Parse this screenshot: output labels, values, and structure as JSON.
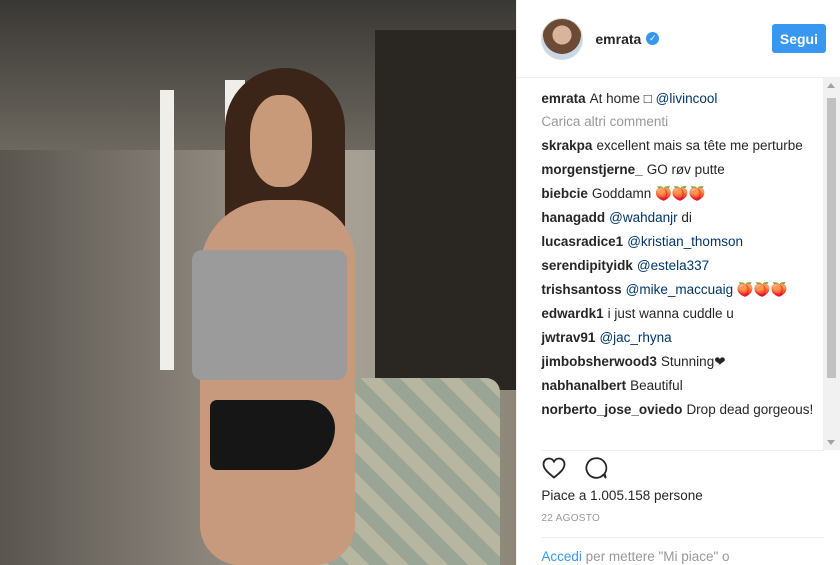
{
  "post": {
    "username": "emrata",
    "verified_icon": "verified-badge-icon",
    "follow_label": "Segui",
    "caption": {
      "author": "emrata",
      "text": "At home □",
      "mention": "@livincool"
    },
    "load_more_label": "Carica altri commenti",
    "comments": [
      {
        "author": "skrakpa",
        "text": "excellent mais sa tête me perturbe",
        "mention": ""
      },
      {
        "author": "morgenstjerne_",
        "text": "GO røv putte",
        "mention": ""
      },
      {
        "author": "biebcie",
        "text": "Goddamn 🍑🍑🍑",
        "mention": ""
      },
      {
        "author": "hanagadd",
        "text": "",
        "mention": "@wahdanjr",
        "after": " di"
      },
      {
        "author": "lucasradice1",
        "text": "",
        "mention": "@kristian_thomson"
      },
      {
        "author": "serendipityidk",
        "text": "",
        "mention": "@estela337"
      },
      {
        "author": "trishsantoss",
        "text": "",
        "mention": "@mike_maccuaig",
        "after": " 🍑🍑🍑"
      },
      {
        "author": "edwardk1",
        "text": "i just wanna cuddle u",
        "mention": ""
      },
      {
        "author": "jwtrav91",
        "text": "",
        "mention": "@jac_rhyna"
      },
      {
        "author": "jimbobsherwood3",
        "text": "Stunning❤",
        "mention": ""
      },
      {
        "author": "nabhanalbert",
        "text": "Beautiful",
        "mention": ""
      },
      {
        "author": "norberto_jose_oviedo",
        "text": "Drop dead gorgeous!",
        "mention": ""
      }
    ],
    "likes_label": "Piace a 1.005.158 persone",
    "date_label": "22 AGOSTO",
    "login_link": "Accedi",
    "login_text": " per mettere \"Mi piace\" o"
  },
  "colors": {
    "accent": "#3897f0",
    "text": "#262626",
    "muted": "#999999",
    "mention": "#003569"
  }
}
